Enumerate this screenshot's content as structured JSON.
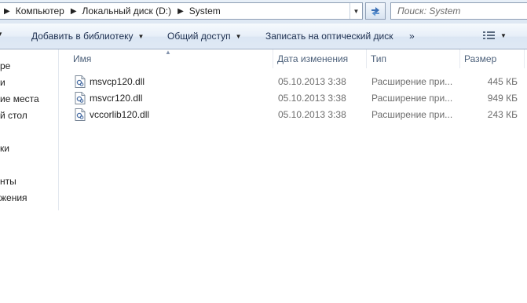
{
  "address": {
    "crumbs": [
      "Компьютер",
      "Локальный диск (D:)",
      "System"
    ],
    "search_placeholder": "Поиск: System"
  },
  "toolbar": {
    "add_to_library": "Добавить в библиотеку",
    "share": "Общий доступ",
    "burn": "Записать на оптический диск",
    "more": "»"
  },
  "nav": {
    "items": [
      "ре",
      "и",
      "ие места",
      "й стол",
      "ки",
      "нты",
      "жения"
    ]
  },
  "columns": {
    "name": "Имя",
    "date": "Дата изменения",
    "type": "Тип",
    "size": "Размер"
  },
  "files": [
    {
      "name": "msvcp120.dll",
      "date": "05.10.2013 3:38",
      "type": "Расширение при...",
      "size": "445 КБ"
    },
    {
      "name": "msvcr120.dll",
      "date": "05.10.2013 3:38",
      "type": "Расширение при...",
      "size": "949 КБ"
    },
    {
      "name": "vccorlib120.dll",
      "date": "05.10.2013 3:38",
      "type": "Расширение при...",
      "size": "243 КБ"
    }
  ],
  "icons": {
    "file": "dll-file-icon",
    "refresh": "refresh-icon",
    "views": "views-icon"
  }
}
